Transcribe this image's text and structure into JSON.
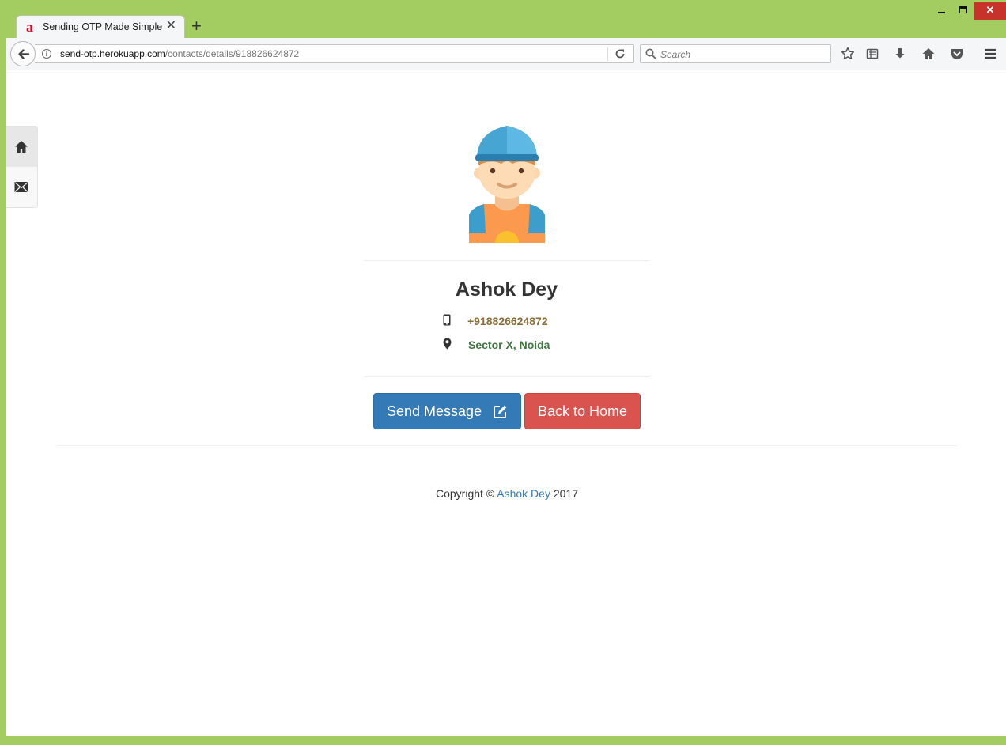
{
  "browser": {
    "tab_title": "Sending OTP Made Simple",
    "tab_favicon": "a",
    "new_tab_label": "+",
    "url_host": "send-otp.herokuapp.com",
    "url_path": "/contacts/details/918826624872",
    "search_placeholder": "Search",
    "window_controls": {
      "close_symbol": "✕"
    }
  },
  "sidebar": {
    "items": [
      {
        "icon": "home-icon",
        "active": true
      },
      {
        "icon": "envelope-icon",
        "active": false
      }
    ]
  },
  "contact": {
    "name": "Ashok Dey",
    "phone": "+918826624872",
    "address": "Sector X, Noida",
    "avatar": "boy-with-cap-avatar"
  },
  "actions": {
    "send_message_label": "Send Message",
    "back_home_label": "Back to Home"
  },
  "footer": {
    "prefix": "Copyright ©",
    "author": "Ashok Dey",
    "year": "2017"
  },
  "colors": {
    "window_frame": "#a3cd61",
    "primary": "#337ab7",
    "danger": "#d9534f",
    "phone_text": "#8a6d3b",
    "address_text": "#3c763d"
  }
}
